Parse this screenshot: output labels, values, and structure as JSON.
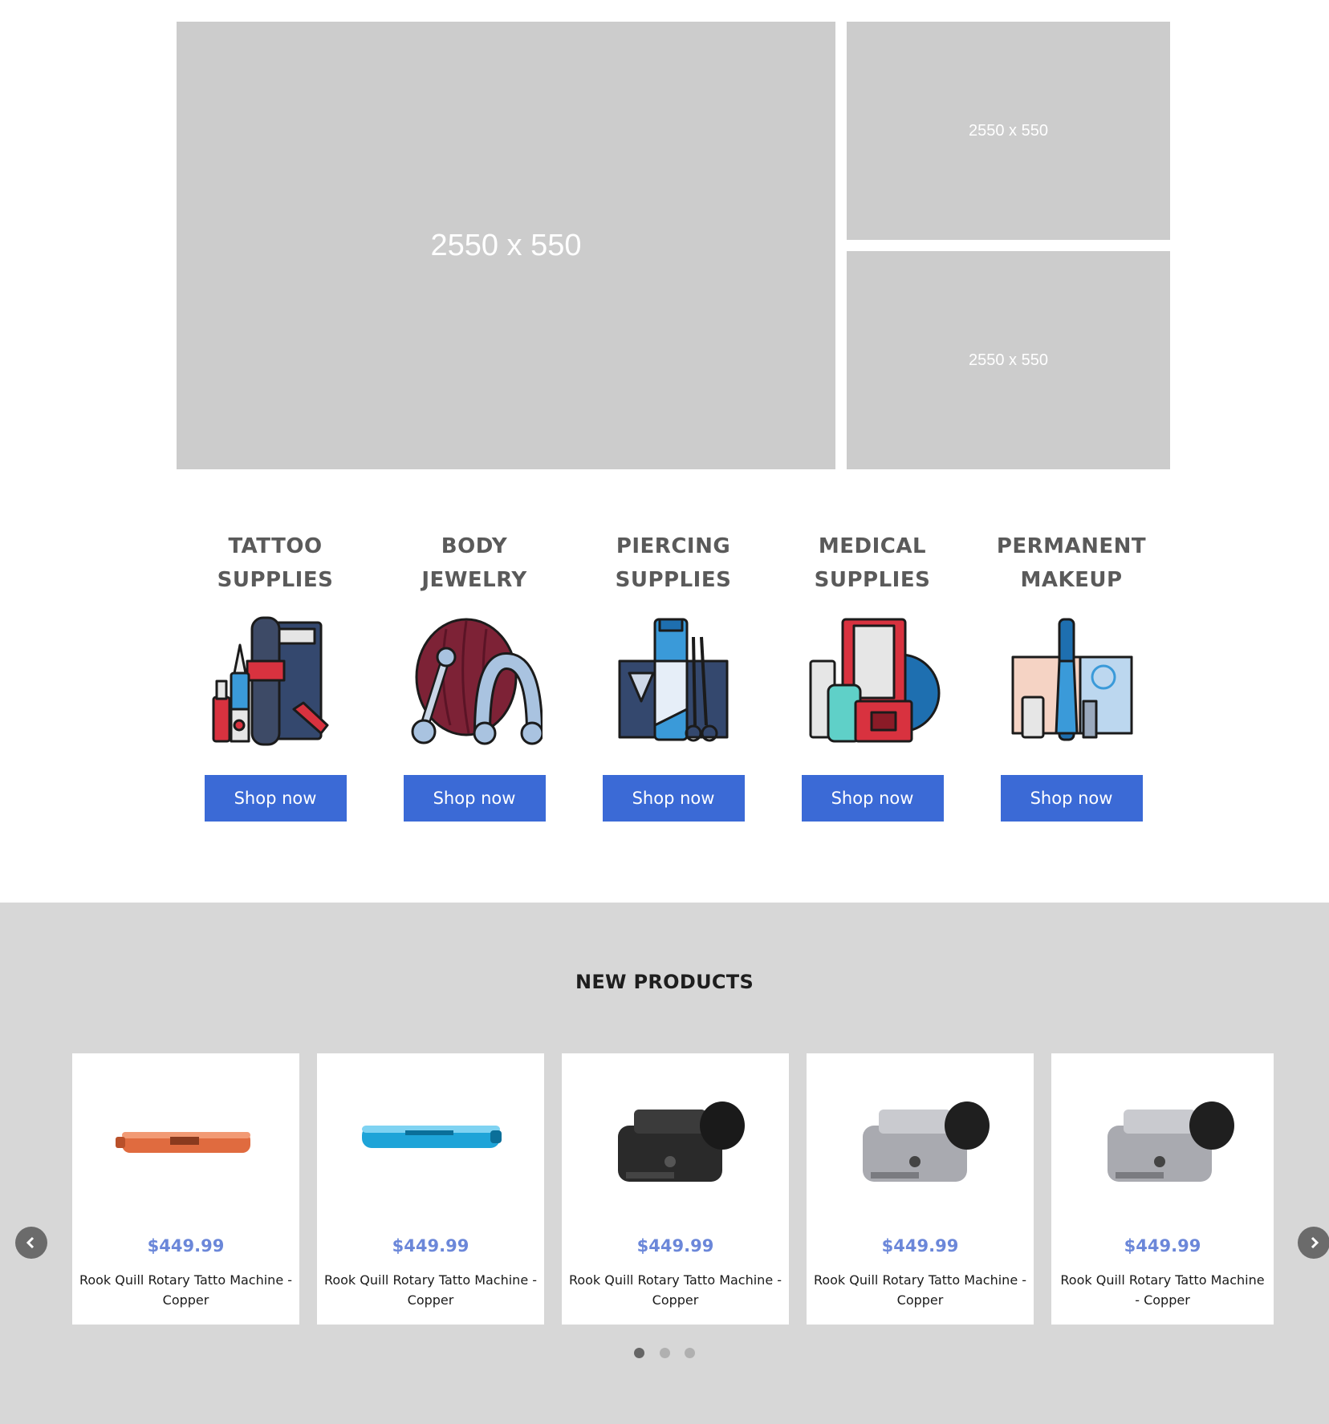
{
  "hero": {
    "main_label": "2550 x 550",
    "side_top_label": "2550 x 550",
    "side_bottom_label": "2550 x 550"
  },
  "categories": [
    {
      "line1": "TATTOO",
      "line2": "SUPPLIES",
      "button": "Shop now",
      "icon": "tattoo-supplies-icon"
    },
    {
      "line1": "BODY",
      "line2": "JEWELRY",
      "button": "Shop now",
      "icon": "body-jewelry-icon"
    },
    {
      "line1": "PIERCING",
      "line2": "SUPPLIES",
      "button": "Shop now",
      "icon": "piercing-supplies-icon"
    },
    {
      "line1": "MEDICAL",
      "line2": "SUPPLIES",
      "button": "Shop now",
      "icon": "medical-supplies-icon"
    },
    {
      "line1": "PERMANENT",
      "line2": "MAKEUP",
      "button": "Shop now",
      "icon": "permanent-makeup-icon"
    }
  ],
  "new_products": {
    "title": "NEW PRODUCTS",
    "items": [
      {
        "price": "$449.99",
        "name": "Rook Quill Rotary Tatto Machine - Copper",
        "image": "copper-pen-machine"
      },
      {
        "price": "$449.99",
        "name": "Rook Quill Rotary Tatto Machine - Copper",
        "image": "blue-pen-machine"
      },
      {
        "price": "$449.99",
        "name": "Rook Quill Rotary Tatto Machine - Copper",
        "image": "black-rotary-machine"
      },
      {
        "price": "$449.99",
        "name": "Rook Quill Rotary Tatto Machine - Copper",
        "image": "silver-rotary-machine"
      },
      {
        "price": "$449.99",
        "name": "Rook Quill Rotary Tatto Machine - Copper",
        "image": "silver-rotary-machine"
      }
    ],
    "pagination": {
      "pages": 3,
      "active": 1
    }
  },
  "colors": {
    "button_blue": "#3b6ad6",
    "price_blue": "#6b87d9",
    "placeholder_gray": "#cccccc",
    "section_gray": "#d7d7d7"
  }
}
